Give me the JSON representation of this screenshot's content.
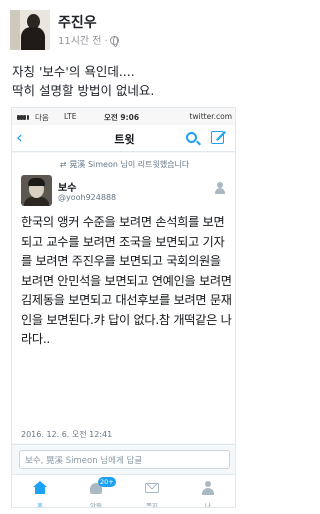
{
  "post": {
    "author": "주진우",
    "time": "11시간 전 ·",
    "caption": "자칭 '보수'의 욕인데....\n딱히 설명할 방법이 없네요."
  },
  "screenshot": {
    "status_bar": {
      "carrier": "다음",
      "network": "LTE",
      "clock": "오전 9:06",
      "url": "twitter.com"
    },
    "header": {
      "back": "‹",
      "title": "트윗"
    },
    "tweet": {
      "retweet_line": "晃溪 Simeon 님이 리트윗했습니다",
      "name": "보수",
      "handle": "@yooh924888",
      "text": "한국의 앵커 수준을 보려면 손석희를 보면 되고 교수를 보려면 조국을 보면되고 기자를 보려면 주진우를 보면되고 국회의원을 보려면 안민석을 보면되고 연예인을 보려면 김제동을 보면되고 대선후보를 보려면 문재인을 보면된다.캬 답이 없다.참 개떡같은 나라다..",
      "date": "2016. 12. 6. 오전 12:41"
    },
    "reply_placeholder": "보수, 晃溪 Simeon 님에게 답글",
    "tabs": [
      {
        "label": "홈",
        "icon": "home-icon",
        "active": true
      },
      {
        "label": "알림",
        "icon": "bell-icon",
        "badge": "20+"
      },
      {
        "label": "쪽지",
        "icon": "message-icon"
      },
      {
        "label": "나",
        "icon": "profile-icon"
      }
    ],
    "accent_color": "#1da1f2"
  }
}
